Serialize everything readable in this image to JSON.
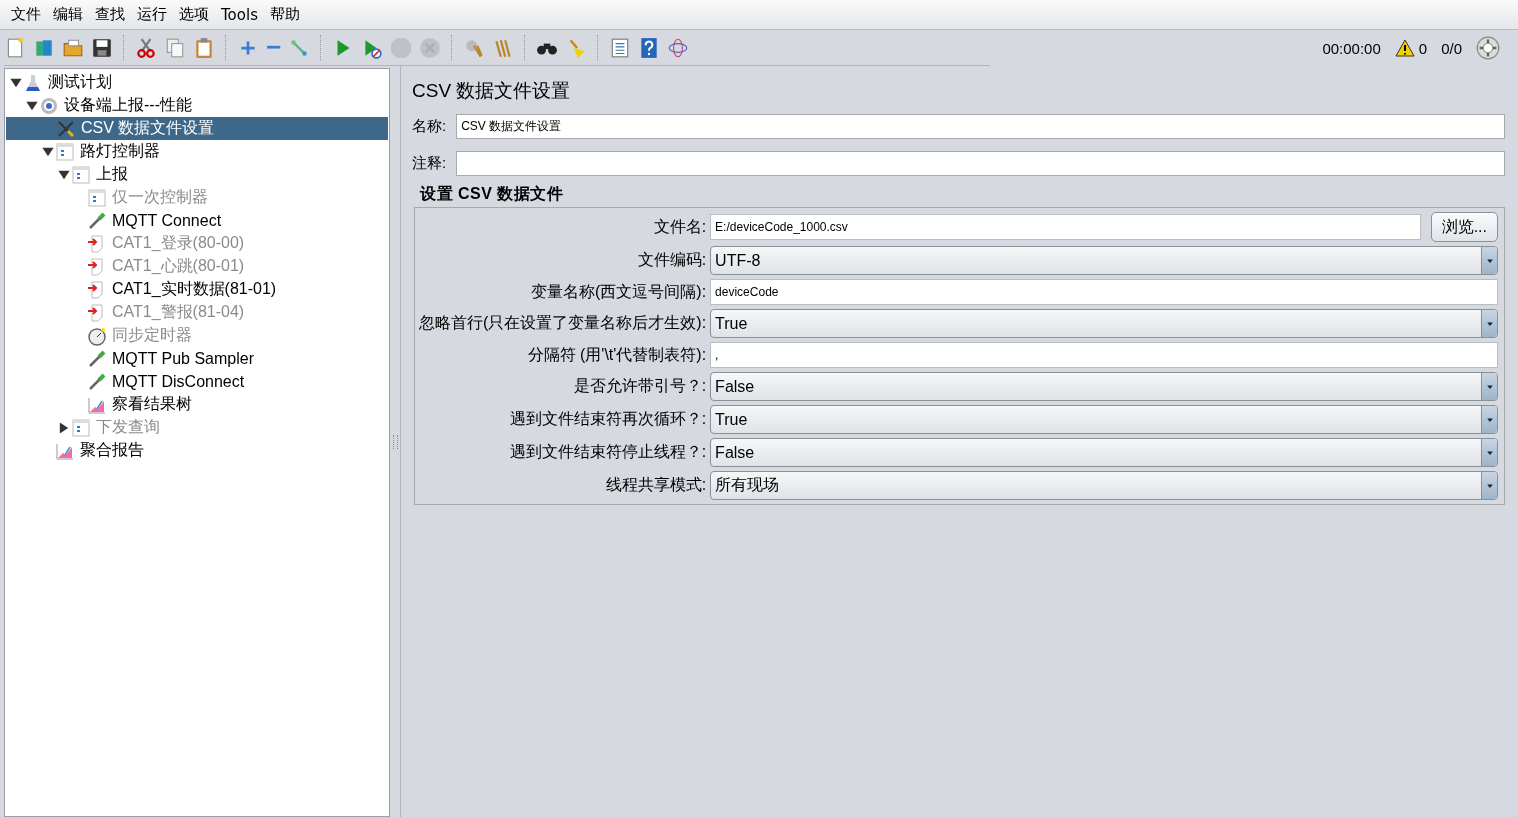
{
  "menu": [
    "文件",
    "编辑",
    "查找",
    "运行",
    "选项",
    "Tools",
    "帮助"
  ],
  "toolbar": [
    [
      {
        "kind": "new",
        "disabled": false
      },
      {
        "kind": "templates",
        "disabled": false
      },
      {
        "kind": "open",
        "disabled": false
      },
      {
        "kind": "save",
        "disabled": false
      }
    ],
    [
      {
        "kind": "cut",
        "disabled": false
      },
      {
        "kind": "copy",
        "disabled": false
      },
      {
        "kind": "paste",
        "disabled": false
      }
    ],
    [
      {
        "kind": "expand",
        "disabled": false
      },
      {
        "kind": "collapse",
        "disabled": false
      },
      {
        "kind": "toggle",
        "disabled": false
      }
    ],
    [
      {
        "kind": "start",
        "disabled": false
      },
      {
        "kind": "start-no-pause",
        "disabled": false
      },
      {
        "kind": "stop",
        "disabled": true
      },
      {
        "kind": "shutdown",
        "disabled": true
      }
    ],
    [
      {
        "kind": "clear",
        "disabled": false
      },
      {
        "kind": "clear-all",
        "disabled": false
      }
    ],
    [
      {
        "kind": "search",
        "disabled": false
      },
      {
        "kind": "reset-search",
        "disabled": false
      }
    ],
    [
      {
        "kind": "functions",
        "disabled": false
      },
      {
        "kind": "help",
        "disabled": false
      },
      {
        "kind": "log",
        "disabled": false
      }
    ]
  ],
  "status": {
    "timer": "00:00:00",
    "warnings": "0",
    "threads": "0/0"
  },
  "tree": [
    {
      "label": "测试计划",
      "kind": "plan",
      "expanded": true,
      "selected": false,
      "disabled": false,
      "children": [
        {
          "label": "设备端上报---性能",
          "kind": "thread-group",
          "expanded": true,
          "selected": false,
          "disabled": false,
          "children": [
            {
              "label": "CSV 数据文件设置",
              "kind": "config",
              "selected": true,
              "disabled": false
            },
            {
              "label": "路灯控制器",
              "kind": "controller",
              "expanded": true,
              "selected": false,
              "disabled": false,
              "children": [
                {
                  "label": "上报",
                  "kind": "controller",
                  "expanded": true,
                  "selected": false,
                  "disabled": false,
                  "children": [
                    {
                      "label": "仅一次控制器",
                      "kind": "controller",
                      "selected": false,
                      "disabled": true
                    },
                    {
                      "label": "MQTT Connect",
                      "kind": "pipette",
                      "selected": false,
                      "disabled": false
                    },
                    {
                      "label": "CAT1_登录(80-00)",
                      "kind": "tcp",
                      "selected": false,
                      "disabled": true
                    },
                    {
                      "label": "CAT1_心跳(80-01)",
                      "kind": "tcp",
                      "selected": false,
                      "disabled": true
                    },
                    {
                      "label": "CAT1_实时数据(81-01)",
                      "kind": "tcp",
                      "selected": false,
                      "disabled": false
                    },
                    {
                      "label": "CAT1_警报(81-04)",
                      "kind": "tcp",
                      "selected": false,
                      "disabled": true
                    },
                    {
                      "label": "同步定时器",
                      "kind": "timer",
                      "selected": false,
                      "disabled": true
                    },
                    {
                      "label": "MQTT Pub Sampler",
                      "kind": "pipette",
                      "selected": false,
                      "disabled": false
                    },
                    {
                      "label": "MQTT DisConnect",
                      "kind": "pipette",
                      "selected": false,
                      "disabled": false
                    },
                    {
                      "label": "察看结果树",
                      "kind": "listener",
                      "selected": false,
                      "disabled": false
                    }
                  ]
                },
                {
                  "label": "下发查询",
                  "kind": "controller",
                  "expanded": false,
                  "selected": false,
                  "disabled": true
                }
              ]
            },
            {
              "label": "聚合报告",
              "kind": "listener",
              "selected": false,
              "disabled": false
            }
          ]
        }
      ]
    }
  ],
  "panel": {
    "title": "CSV 数据文件设置",
    "name_label": "名称:",
    "name_value": "CSV 数据文件设置",
    "comment_label": "注释:",
    "section_title": "设置 CSV 数据文件",
    "rows": [
      {
        "kind": "file",
        "label": "文件名:",
        "value": "E:/deviceCode_1000.csv",
        "button": "浏览..."
      },
      {
        "kind": "select",
        "label": "文件编码:",
        "value": "UTF-8"
      },
      {
        "kind": "text",
        "label": "变量名称(西文逗号间隔):",
        "value": "deviceCode"
      },
      {
        "kind": "select",
        "label": "忽略首行(只在设置了变量名称后才生效):",
        "value": "True"
      },
      {
        "kind": "text",
        "label": "分隔符 (用'\\t'代替制表符):",
        "value": ","
      },
      {
        "kind": "select",
        "label": "是否允许带引号？:",
        "value": "False"
      },
      {
        "kind": "select",
        "label": "遇到文件结束符再次循环？:",
        "value": "True"
      },
      {
        "kind": "select",
        "label": "遇到文件结束符停止线程？:",
        "value": "False"
      },
      {
        "kind": "select",
        "label": "线程共享模式:",
        "value": "所有现场"
      }
    ]
  }
}
